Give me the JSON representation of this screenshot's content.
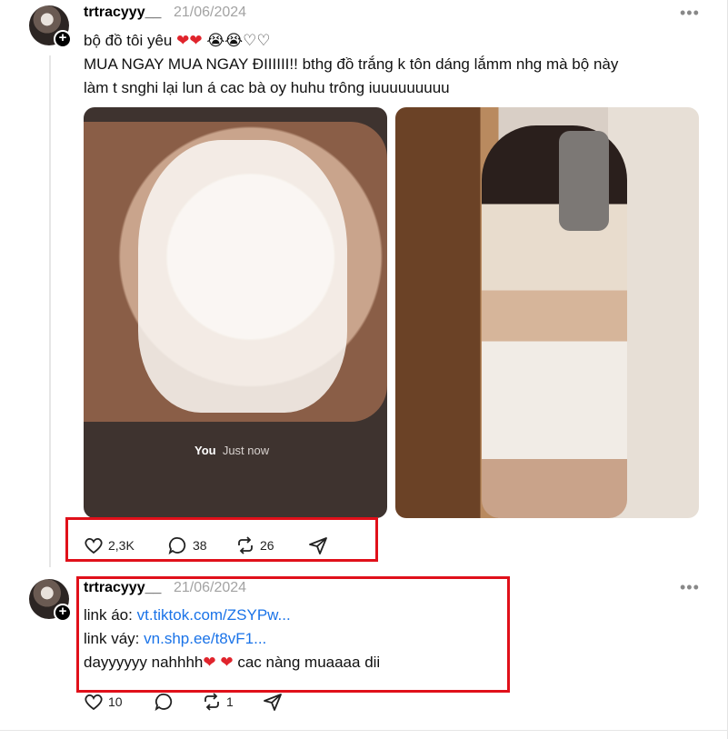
{
  "post1": {
    "username": "trtracyyy__",
    "date": "21/06/2024",
    "more_label": "•••",
    "line1_text": "bộ đồ tôi yêu",
    "line1_emoji": [
      "❤",
      "❤",
      "😭",
      "😭",
      "♡",
      "♡"
    ],
    "line2": "MUA NGAY MUA NGAY ĐIIIIII!! bthg đồ trắng k tôn dáng lắmm nhg mà bộ này",
    "line3": "làm t snghi lại lun á cac bà oy huhu trông iuuuuuuuuu",
    "story_user": "You",
    "story_time": "Just now",
    "likes": "2,3K",
    "comments": "38",
    "reposts": "26"
  },
  "post2": {
    "username": "trtracyyy__",
    "date": "21/06/2024",
    "more_label": "•••",
    "line1_label": "link áo: ",
    "line1_link": "vt.tiktok.com/ZSYPw...",
    "line2_label": "link váy: ",
    "line2_link": "vn.shp.ee/t8vF1...",
    "line3_text": "dayyyyyy nahhhh",
    "line3_hearts": "❤ ❤",
    "line3_tail": " cac nàng muaaaa dii",
    "likes": "10",
    "reposts": "1"
  },
  "colors": {
    "accent_link": "#1a73e8",
    "highlight": "#e0101a",
    "heart": "#e0242c"
  },
  "icons": [
    "heart-icon",
    "comment-icon",
    "repost-icon",
    "share-icon",
    "plus-icon",
    "more-icon"
  ]
}
